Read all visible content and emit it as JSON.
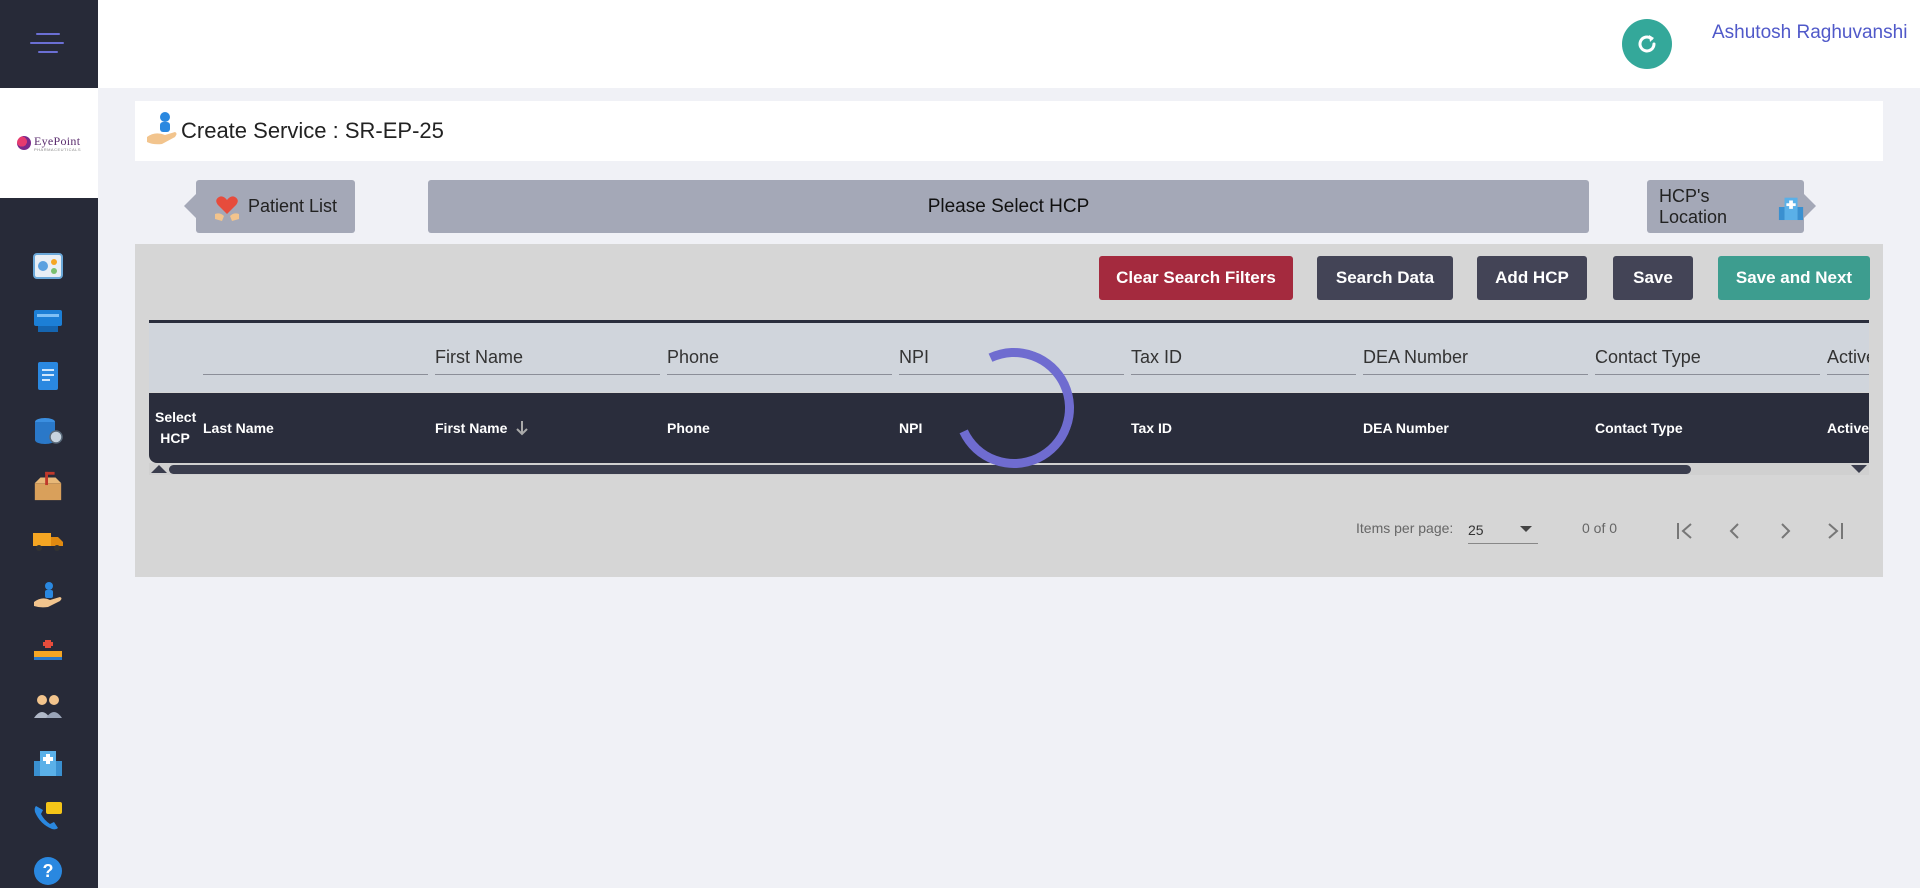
{
  "topbar": {
    "user_name": "Ashutosh Raghuvanshi",
    "refresh_color": "#34a89a"
  },
  "sidebar": {
    "logo_text": "EyePoint",
    "logo_sub": "PHARMACEUTICALS",
    "icons": [
      "dashboard-icon",
      "inbox-icon",
      "document-icon",
      "database-settings-icon",
      "package-icon",
      "delivery-truck-icon",
      "service-hand-icon",
      "hospital-bed-icon",
      "users-icon",
      "hospital-building-icon",
      "phone-chat-icon",
      "help-icon"
    ]
  },
  "page": {
    "title": "Create Service : SR-EP-25"
  },
  "steps": {
    "prev_label": "Patient List",
    "current_label": "Please Select HCP",
    "next_label": "HCP's Location"
  },
  "toolbar": {
    "clear_filters": "Clear Search Filters",
    "search_data": "Search Data",
    "add_hcp": "Add HCP",
    "save": "Save",
    "save_next": "Save and Next"
  },
  "table": {
    "filters": [
      "",
      "First Name",
      "Phone",
      "NPI",
      "Tax ID",
      "DEA Number",
      "Contact Type",
      "Active"
    ],
    "headers": {
      "select": "Select HCP",
      "last_name": "Last Name",
      "first_name": "First Name",
      "phone": "Phone",
      "npi": "NPI",
      "tax_id": "Tax ID",
      "dea_number": "DEA Number",
      "contact_type": "Contact Type",
      "active": "Active"
    },
    "sorted_column": "First Name",
    "sort_direction": "descending"
  },
  "paginator": {
    "items_per_page_label": "Items per page:",
    "items_per_page": "25",
    "range": "0 of 0"
  },
  "colors": {
    "sidebar": "#272a38",
    "accent": "#5059c9",
    "danger": "#a42a3e",
    "teal": "#3d9d8f",
    "spinner": "#6f6cd0"
  }
}
